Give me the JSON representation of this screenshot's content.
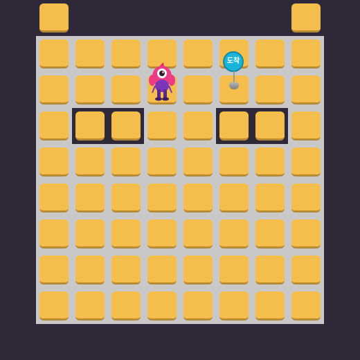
{
  "game": {
    "grid_rows": 8,
    "grid_cols": 8,
    "goal": {
      "label": "도착",
      "row": 1,
      "col": 5
    },
    "player": {
      "row": 1,
      "col": 3
    },
    "holes": [
      {
        "row": 2,
        "cols": [
          1,
          2
        ]
      },
      {
        "row": 2,
        "cols": [
          5,
          6
        ]
      }
    ],
    "colors": {
      "background": "#2e2838",
      "board": "#c8c8c8",
      "tile": "#f5bd4b",
      "goal": "#19b4d8",
      "player_body": "#ee3b85",
      "player_legs": "#7b35b8"
    }
  }
}
